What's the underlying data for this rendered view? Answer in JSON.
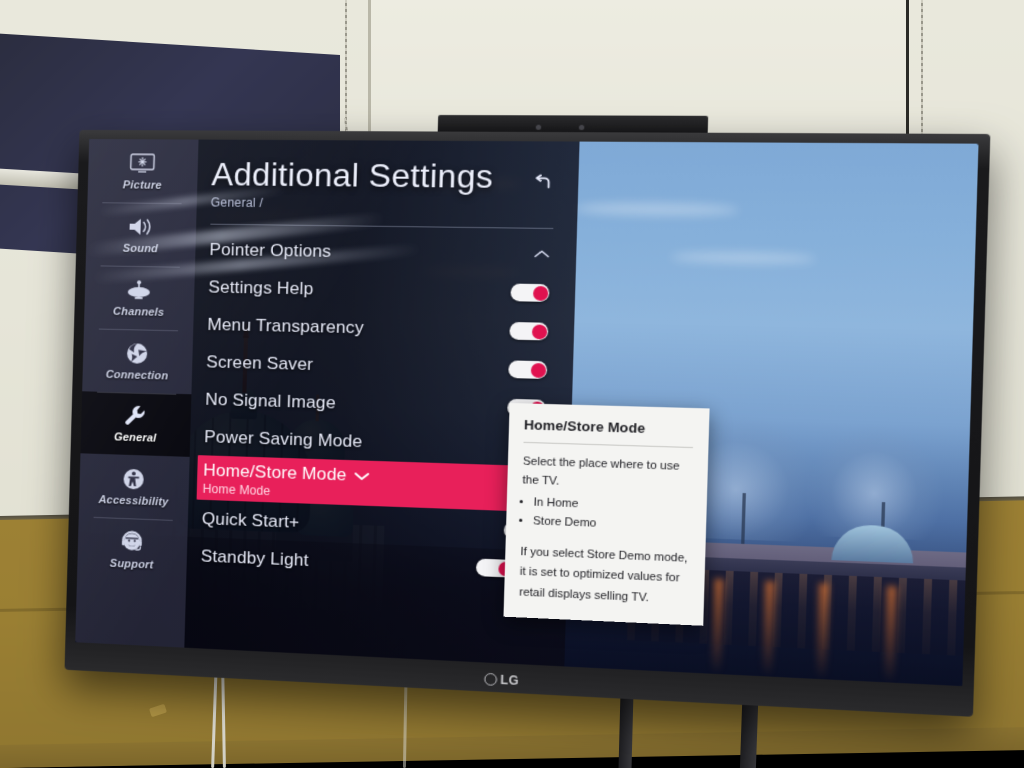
{
  "device": {
    "brand": "LG"
  },
  "screen": {
    "header": {
      "title": "Additional Settings",
      "breadcrumb": "General /",
      "back_icon": "undo-arrow-icon"
    },
    "sidebar": {
      "items": [
        {
          "label": "Picture",
          "icon": "picture-icon",
          "active": false
        },
        {
          "label": "Sound",
          "icon": "speaker-icon",
          "active": false
        },
        {
          "label": "Channels",
          "icon": "satellite-dish-icon",
          "active": false
        },
        {
          "label": "Connection",
          "icon": "globe-icon",
          "active": false
        },
        {
          "label": "General",
          "icon": "wrench-icon",
          "active": true
        },
        {
          "label": "Accessibility",
          "icon": "accessibility-icon",
          "active": false
        },
        {
          "label": "Support",
          "icon": "headset-icon",
          "active": false
        }
      ]
    },
    "menu_rows": [
      {
        "label": "Pointer Options",
        "control": "chevron-up",
        "value": ""
      },
      {
        "label": "Settings Help",
        "control": "toggle-on",
        "value": "On"
      },
      {
        "label": "Menu Transparency",
        "control": "toggle-on",
        "value": "On"
      },
      {
        "label": "Screen Saver",
        "control": "toggle-on",
        "value": "On"
      },
      {
        "label": "No Signal Image",
        "control": "toggle-on",
        "value": "On"
      },
      {
        "label": "Power Saving Mode",
        "control": "none",
        "value": ""
      },
      {
        "label": "Home/Store Mode",
        "control": "chevron-down",
        "value": "Home Mode",
        "selected": true
      },
      {
        "label": "Quick Start+",
        "control": "toggle-on",
        "value": "On"
      },
      {
        "label": "Standby Light",
        "control": "toggle-on",
        "value": "On"
      }
    ],
    "scroll_down_icon": "chevron-down-icon",
    "info_panel": {
      "title": "Home/Store Mode",
      "intro": "Select the place where to use the TV.",
      "options": [
        "In Home",
        "Store Demo"
      ],
      "note": "If you select Store Demo mode, it is set to optimized values for retail displays selling TV."
    },
    "wallpaper": {
      "description": "Berlin Cathedral at dusk"
    }
  },
  "colors": {
    "highlight": "#e8205a",
    "toggle_knob": "#e0124f",
    "toggle_track": "#f4f4f6",
    "menu_text": "#e9ecfa",
    "sidebar_bg": "#2e2f44",
    "info_bg": "#f4f4f2"
  }
}
